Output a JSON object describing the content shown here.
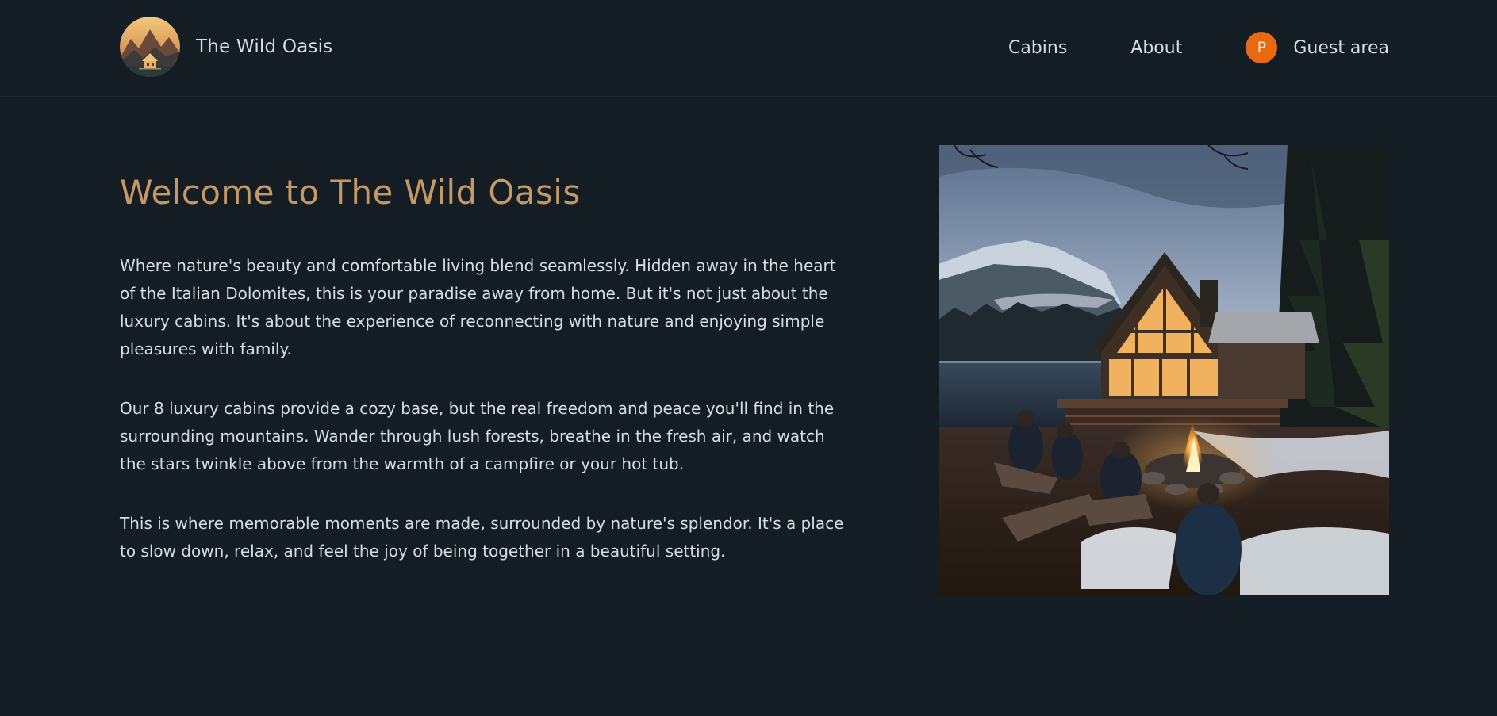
{
  "header": {
    "logo_alt": "The Wild Oasis logo",
    "brand_name": "The Wild Oasis",
    "nav": {
      "cabins_label": "Cabins",
      "about_label": "About",
      "guest_label": "Guest area",
      "avatar_initial": "P"
    }
  },
  "main": {
    "title": "Welcome to The Wild Oasis",
    "paragraphs": [
      "Where nature's beauty and comfortable living blend seamlessly. Hidden away in the heart of the Italian Dolomites, this is your paradise away from home. But it's not just about the luxury cabins. It's about the experience of reconnecting with nature and enjoying simple pleasures with family.",
      "Our 8 luxury cabins provide a cozy base, but the real freedom and peace you'll find in the surrounding mountains. Wander through lush forests, breathe in the fresh air, and watch the stars twinkle above from the warmth of a campfire or your hot tub.",
      "This is where memorable moments are made, surrounded by nature's splendor. It's a place to slow down, relax, and feel the joy of being together in a beautiful setting."
    ],
    "hero_image_alt": "Cabin by a lake with a campfire"
  },
  "colors": {
    "background": "#141c24",
    "text": "#d4dee7",
    "accent": "#c69963",
    "avatar": "#e8690f"
  }
}
